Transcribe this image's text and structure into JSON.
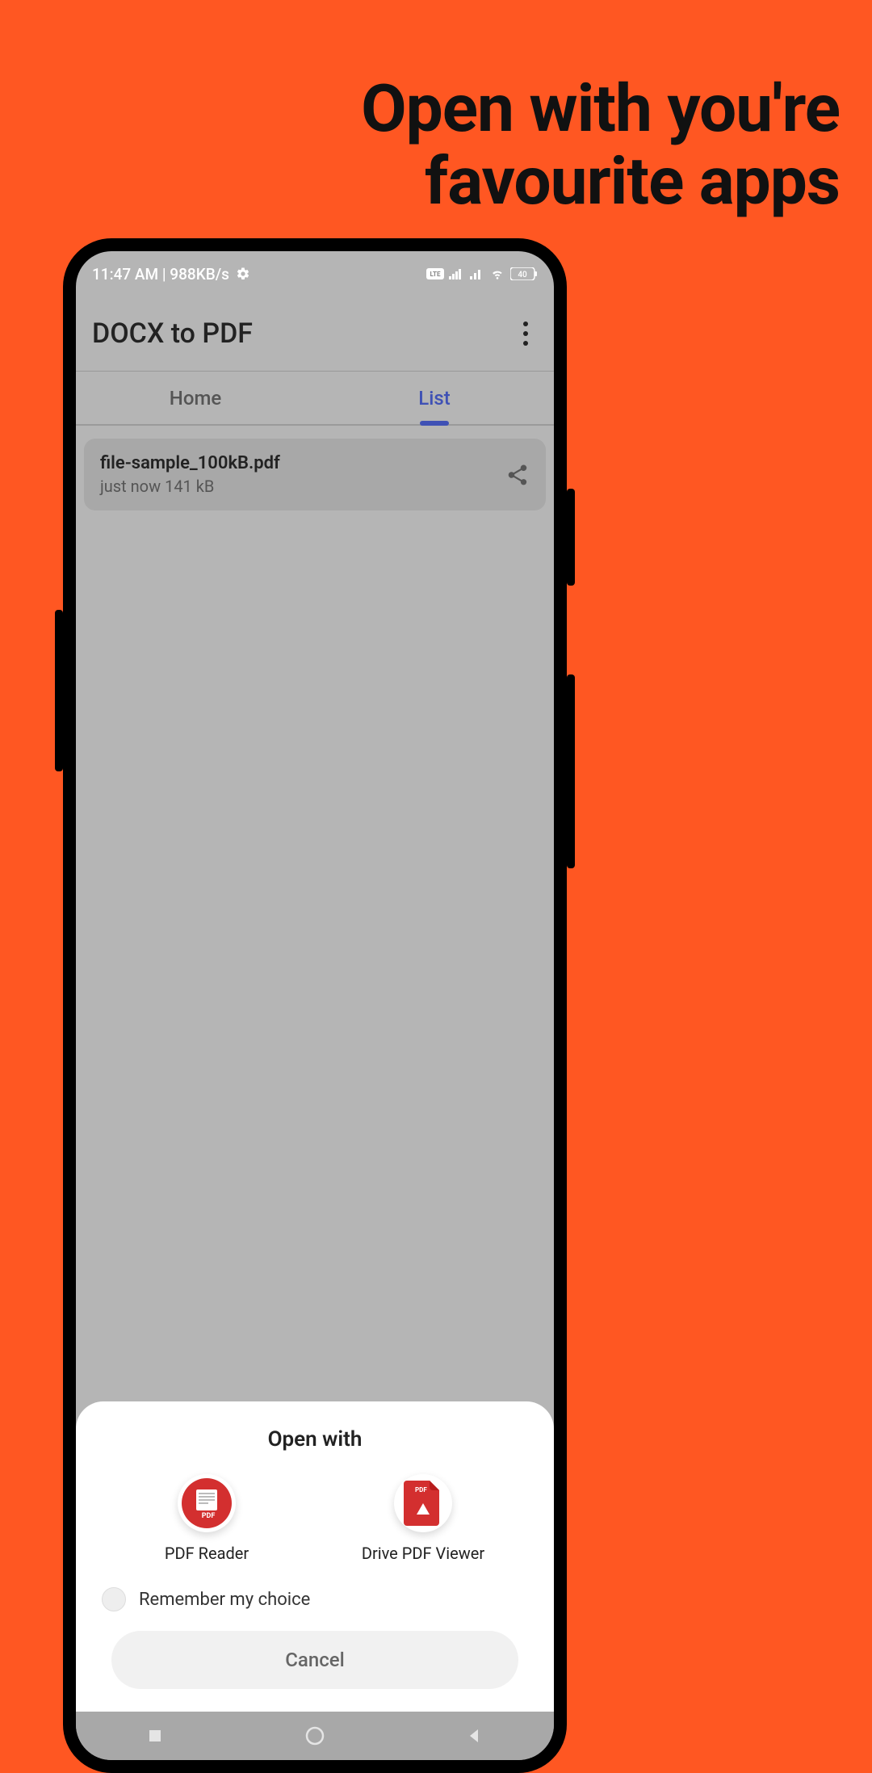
{
  "promo": {
    "headline": "Open with you're favourite apps"
  },
  "statusbar": {
    "left_text": "11:47 AM | 988KB/s",
    "battery": "40"
  },
  "appbar": {
    "title": "DOCX to PDF"
  },
  "tabs": {
    "home": "Home",
    "list": "List",
    "active": "list"
  },
  "file": {
    "name": "file-sample_100kB.pdf",
    "meta": "just now  141 kB"
  },
  "sheet": {
    "title": "Open with",
    "apps": {
      "pdfreader": "PDF Reader",
      "drive": "Drive PDF Viewer"
    },
    "remember": "Remember my choice",
    "cancel": "Cancel"
  }
}
